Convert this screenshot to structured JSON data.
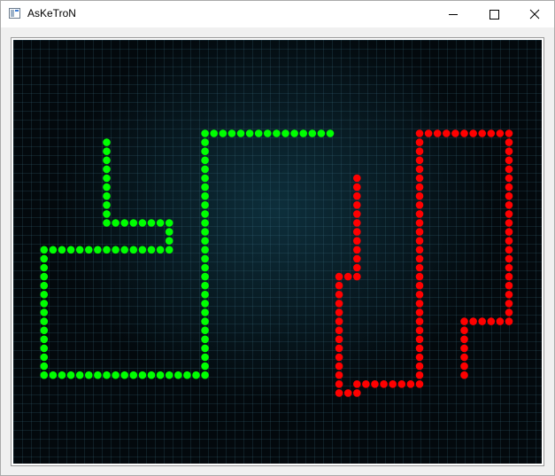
{
  "window": {
    "title": "AsKeTroN",
    "icon": "app-window-icon",
    "controls": [
      "minimize-icon",
      "maximize-icon",
      "close-icon"
    ]
  },
  "game": {
    "grid_columns": 58,
    "grid_rows": 47,
    "players": [
      {
        "id": "green",
        "color": "#00ff00",
        "trail": [
          [
            10,
            11
          ],
          [
            10,
            20
          ],
          [
            17,
            20
          ],
          [
            17,
            23
          ],
          [
            3,
            23
          ],
          [
            3,
            37
          ],
          [
            21,
            37
          ],
          [
            21,
            10
          ],
          [
            35,
            10
          ]
        ]
      },
      {
        "id": "red",
        "color": "#ff0000",
        "trail": [
          [
            38,
            15
          ],
          [
            38,
            26
          ],
          [
            36,
            26
          ],
          [
            36,
            39
          ],
          [
            38,
            39
          ],
          [
            38,
            38
          ],
          [
            45,
            38
          ],
          [
            45,
            10
          ],
          [
            55,
            10
          ],
          [
            55,
            31
          ],
          [
            50,
            31
          ],
          [
            50,
            37
          ]
        ]
      }
    ]
  }
}
